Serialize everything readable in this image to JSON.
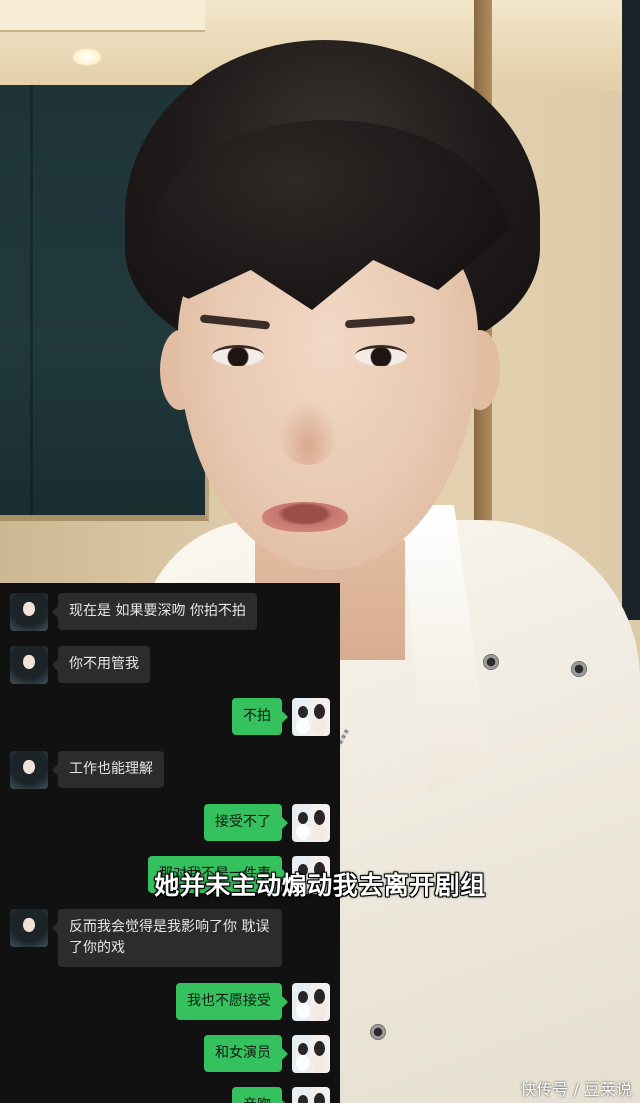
{
  "chat": {
    "messages": [
      {
        "side": "left",
        "text": "现在是 如果要深吻 你拍不拍"
      },
      {
        "side": "left",
        "text": "你不用管我"
      },
      {
        "side": "right",
        "text": "不拍"
      },
      {
        "side": "left",
        "text": "工作也能理解"
      },
      {
        "side": "right",
        "text": "接受不了"
      },
      {
        "side": "right",
        "text": "那对我不是一件事"
      },
      {
        "side": "left",
        "text": "反而我会觉得是我影响了你 耽误了你的戏"
      },
      {
        "side": "right",
        "text": "我也不愿接受"
      },
      {
        "side": "right",
        "text": "和女演员"
      },
      {
        "side": "right",
        "text": "亲吻"
      }
    ]
  },
  "subtitle": "她并未主动煽动我去离开剧组",
  "watermark": "快传号 / 豆莱说",
  "colors": {
    "chat_background": "#111111",
    "bubble_left": "#2c2c2c",
    "bubble_right": "#36c15f",
    "subtitle_text": "#ffffff"
  }
}
